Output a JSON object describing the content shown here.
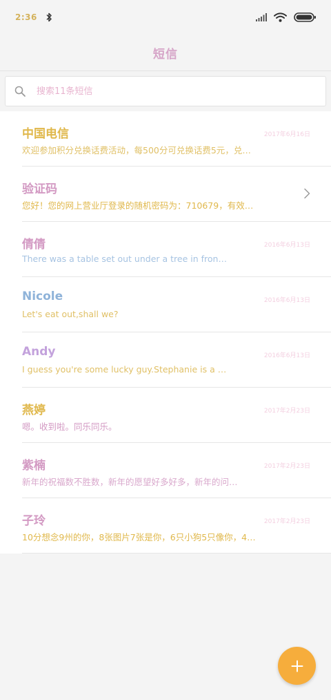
{
  "status_bar": {
    "time": "2:36"
  },
  "header": {
    "title": "短信"
  },
  "search": {
    "placeholder": "搜索11条短信"
  },
  "threads": [
    {
      "name": "中国电信",
      "date": "2017年6月16日",
      "preview": "欢迎参加积分兑换话费活动，每500分可兑换话费5元，兑…",
      "name_color": "#e0b84c",
      "preview_color": "#e0c066"
    },
    {
      "name": "验证码",
      "date": "",
      "preview": "您好！您的网上营业厅登录的随机密码为：710679，有效…",
      "name_color": "#d39ac3",
      "preview_color": "#e0b84c"
    },
    {
      "name": "倩倩",
      "date": "2016年6月13日",
      "preview": "There was a table set out under a tree in fron…",
      "name_color": "#d39ac3",
      "preview_color": "#a6c3e2"
    },
    {
      "name": "Nicole",
      "date": "2016年6月13日",
      "preview": "Let's eat out,shall we?",
      "name_color": "#8fb3d9",
      "preview_color": "#e0c066"
    },
    {
      "name": "Andy",
      "date": "2016年6月13日",
      "preview": "I guess you're some lucky guy.Stephanie is a …",
      "name_color": "#c3a2dc",
      "preview_color": "#e0c066"
    },
    {
      "name": "燕婷",
      "date": "2017年2月23日",
      "preview": "嗯。收到啦。同乐同乐。",
      "name_color": "#e0b84c",
      "preview_color": "#d39ac3"
    },
    {
      "name": "紫楠",
      "date": "2017年2月23日",
      "preview": "新年的祝福数不胜数，新年的愿望好多好多，新年的问…",
      "name_color": "#d39ac3",
      "preview_color": "#d9a8cc"
    },
    {
      "name": "子玲",
      "date": "2017年2月23日",
      "preview": "10分想念9州的你，8张图片7张是你，6只小狗5只像你，4…",
      "name_color": "#d39ac3",
      "preview_color": "#e0b84c"
    }
  ],
  "icons": {
    "bluetooth": "bluetooth-icon",
    "signal": "signal-icon",
    "wifi": "wifi-icon",
    "battery": "battery-icon",
    "search": "search-icon",
    "chevron": "chevron-right-icon",
    "compose": "plus-icon"
  },
  "colors": {
    "fab": "#f6ad3c",
    "title": "#d6a5c8"
  }
}
